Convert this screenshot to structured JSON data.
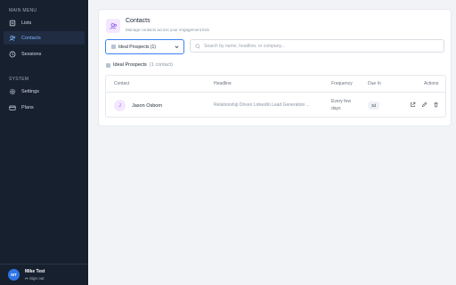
{
  "sidebar": {
    "main_menu_label": "MAIN MENU",
    "system_label": "SYSTEM",
    "items": [
      {
        "label": "Lists",
        "icon": "list-icon"
      },
      {
        "label": "Contacts",
        "icon": "users-icon",
        "active": true
      },
      {
        "label": "Sessions",
        "icon": "clock-icon"
      }
    ],
    "system_items": [
      {
        "label": "Settings",
        "icon": "gear-icon"
      },
      {
        "label": "Plans",
        "icon": "card-icon"
      }
    ],
    "user": {
      "initials": "MT",
      "name": "Mike Test",
      "signout": "Sign out"
    }
  },
  "header": {
    "title": "Contacts",
    "subtitle": "Manage contacts across your engagement lists"
  },
  "filters": {
    "list_select": "Ideal Prospects (1)",
    "search_placeholder": "Search by name, headline, or company..."
  },
  "group": {
    "label": "Ideal Prospects",
    "count": "(1 contact)"
  },
  "table": {
    "columns": [
      "Contact",
      "Headline",
      "Frequency",
      "Due In",
      "Actions"
    ],
    "rows": [
      {
        "initial": "J",
        "name": "Jason Osborn",
        "headline": "Relationship Driven LinkedIn Lead Generation ...",
        "frequency": "Every few days",
        "due_in": "3d"
      }
    ]
  },
  "colors": {
    "accent": "#3b82f6",
    "sidebar_bg": "#17202e",
    "active_text": "#7fb3ff"
  }
}
